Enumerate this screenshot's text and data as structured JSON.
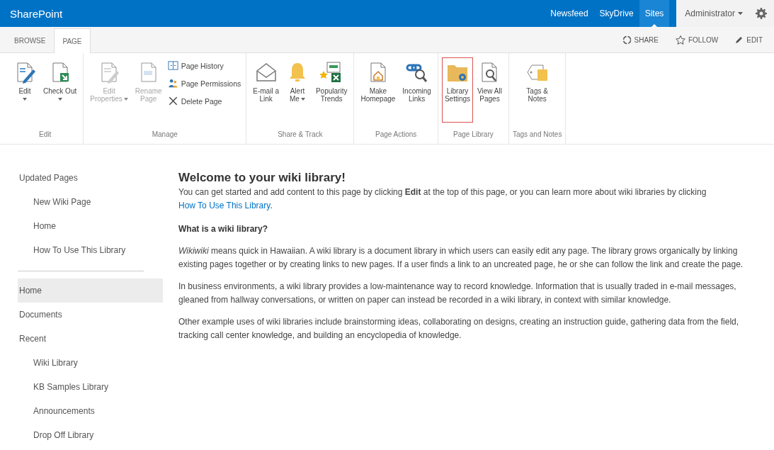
{
  "suite_bar": {
    "brand": "SharePoint",
    "links": [
      {
        "label": "Newsfeed",
        "selected": false
      },
      {
        "label": "SkyDrive",
        "selected": false
      },
      {
        "label": "Sites",
        "selected": true
      }
    ],
    "user": "Administrator"
  },
  "tabs": [
    {
      "label": "BROWSE",
      "selected": false
    },
    {
      "label": "PAGE",
      "selected": true
    }
  ],
  "actions": [
    "SHARE",
    "FOLLOW",
    "EDIT"
  ],
  "ribbon": [
    {
      "label": "Edit",
      "buttons": [
        {
          "kind": "large",
          "lines": [
            "Edit"
          ],
          "dropdown": true,
          "disabled": false,
          "selected": false
        },
        {
          "kind": "large",
          "lines": [
            "Check Out"
          ],
          "dropdown": true,
          "disabled": false,
          "selected": false
        }
      ]
    },
    {
      "label": "Manage",
      "buttons": [
        {
          "kind": "large",
          "lines": [
            "Edit",
            "Properties"
          ],
          "dropdown": true,
          "disabled": true,
          "selected": false
        },
        {
          "kind": "large",
          "lines": [
            "Rename",
            "Page"
          ],
          "dropdown": false,
          "disabled": true,
          "selected": false
        },
        {
          "kind": "small",
          "lines": [
            "Page History"
          ],
          "disabled": false,
          "selected": false
        },
        {
          "kind": "small",
          "lines": [
            "Page Permissions"
          ],
          "disabled": false,
          "selected": false
        },
        {
          "kind": "small",
          "lines": [
            "Delete Page"
          ],
          "disabled": false,
          "selected": false
        }
      ]
    },
    {
      "label": "Share & Track",
      "buttons": [
        {
          "kind": "large",
          "lines": [
            "E-mail a",
            "Link"
          ],
          "dropdown": false,
          "disabled": false,
          "selected": false
        },
        {
          "kind": "large",
          "lines": [
            "Alert",
            "Me"
          ],
          "dropdown": true,
          "disabled": false,
          "selected": false
        },
        {
          "kind": "large",
          "lines": [
            "Popularity",
            "Trends"
          ],
          "dropdown": false,
          "disabled": false,
          "selected": false
        }
      ]
    },
    {
      "label": "Page Actions",
      "buttons": [
        {
          "kind": "large",
          "lines": [
            "Make",
            "Homepage"
          ],
          "dropdown": false,
          "disabled": false,
          "selected": false
        },
        {
          "kind": "large",
          "lines": [
            "Incoming",
            "Links"
          ],
          "dropdown": false,
          "disabled": false,
          "selected": false
        }
      ]
    },
    {
      "label": "Page Library",
      "buttons": [
        {
          "kind": "large",
          "lines": [
            "Library",
            "Settings"
          ],
          "dropdown": false,
          "disabled": false,
          "selected": true
        },
        {
          "kind": "large",
          "lines": [
            "View All",
            "Pages"
          ],
          "dropdown": false,
          "disabled": false,
          "selected": false
        }
      ]
    },
    {
      "label": "Tags and Notes",
      "buttons": [
        {
          "kind": "large",
          "lines": [
            "Tags &",
            "Notes"
          ],
          "dropdown": false,
          "disabled": false,
          "selected": false
        }
      ]
    }
  ],
  "sidebar": {
    "updated": {
      "label": "Updated Pages",
      "children": [
        {
          "label": "New Wiki Page"
        },
        {
          "label": "Home"
        },
        {
          "label": "How To Use This Library"
        }
      ]
    },
    "items": [
      {
        "label": "Home",
        "selected": true
      },
      {
        "label": "Documents",
        "selected": false
      },
      {
        "label": "Recent",
        "selected": false,
        "children": [
          {
            "label": "Wiki Library",
            "selected": false
          },
          {
            "label": "KB Samples Library",
            "selected": false
          },
          {
            "label": "Announcements",
            "selected": false
          },
          {
            "label": "Drop Off Library",
            "selected": false
          }
        ]
      }
    ]
  },
  "content": {
    "title": "Welcome to your wiki library!",
    "intro": {
      "text": "You can get started and add content to this page by clicking **Edit** at the top of this page, or you can learn more about wiki libraries by clicking",
      "link": "How To Use This Library",
      "after": "."
    },
    "heading": "What is a wiki library?",
    "paragraphs": [
      "*Wikiwiki* means quick in Hawaiian. A wiki library is a document library in which users can easily edit any page. The library grows organically by linking existing pages together or by creating links to new pages. If a user finds a link to an uncreated page, he or she can follow the link and create the page.",
      "In business environments, a wiki library provides a low-maintenance way to record knowledge. Information that is usually traded in e-mail messages, gleaned from hallway conversations, or written on paper can instead be recorded in a wiki library, in context with similar knowledge.",
      "Other example uses of wiki libraries include brainstorming ideas, collaborating on designs, creating an instruction guide, gathering data from the field, tracking call center knowledge, and building an encyclopedia of knowledge."
    ]
  }
}
